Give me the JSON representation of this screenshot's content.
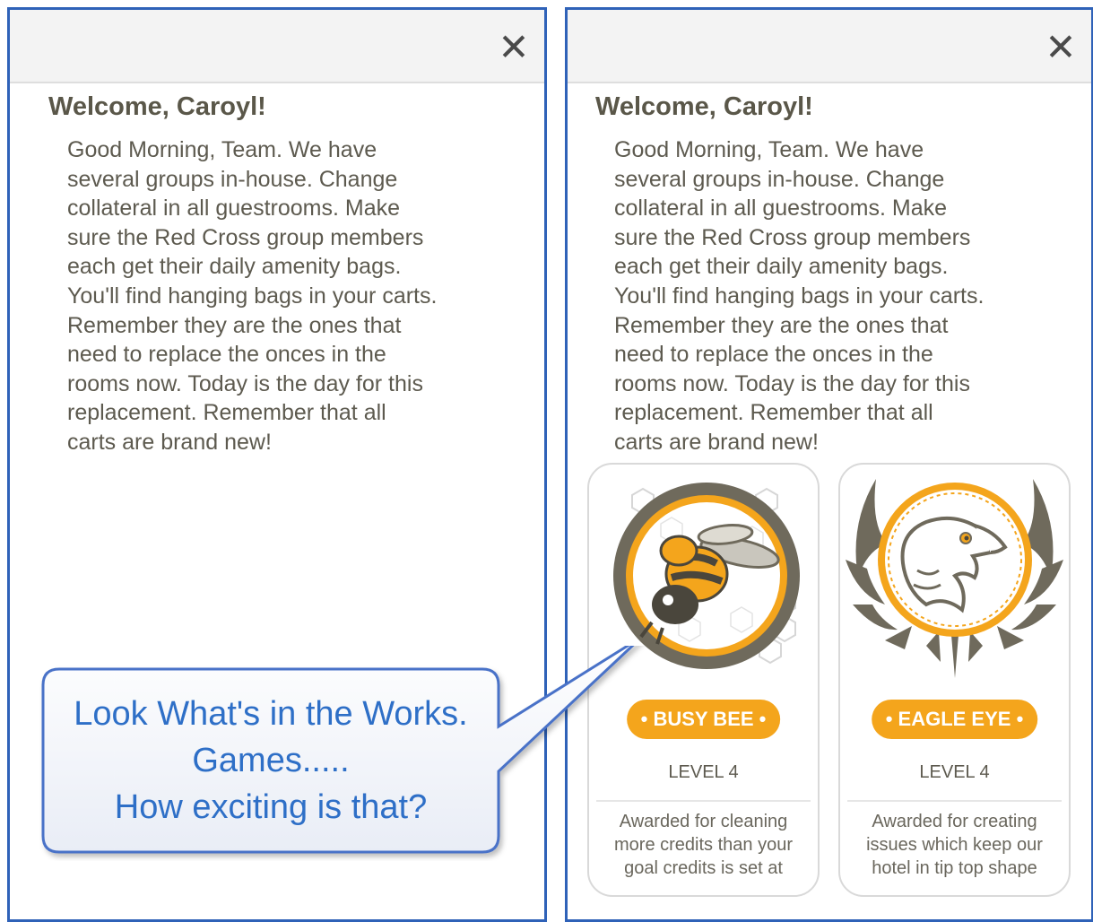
{
  "close_symbol": "✕",
  "left_panel": {
    "welcome": "Welcome, Caroyl!",
    "message_lines": [
      "Good Morning, Team. We have",
      "several groups in-house. Change",
      "collateral in all guestrooms. Make",
      "sure the Red Cross group members",
      "each get their daily amenity bags.",
      "You'll find hanging bags in your carts.",
      "Remember they are the ones that",
      "need to replace the onces in the",
      "rooms now. Today is the day for this",
      "replacement. Remember that all",
      "carts are brand new!"
    ]
  },
  "right_panel": {
    "welcome": "Welcome, Caroyl!",
    "message_lines": [
      "Good Morning, Team. We have",
      "several groups in-house. Change",
      "collateral in all guestrooms. Make",
      "sure the Red Cross group members",
      "each get their daily amenity bags.",
      "You'll find hanging bags in your carts.",
      "Remember they are the ones that",
      "need to replace the onces in the",
      "rooms now. Today is the day for this",
      "replacement. Remember that all",
      "carts are brand new!"
    ],
    "badges": [
      {
        "name": "• BUSY BEE •",
        "level": "LEVEL 4",
        "description": [
          "Awarded for cleaning",
          "more credits than your",
          "goal credits is set at"
        ],
        "icon": "bee-badge-icon"
      },
      {
        "name": "• EAGLE EYE •",
        "level": "LEVEL 4",
        "description": [
          "Awarded for creating",
          "issues which keep our",
          "hotel in tip top shape"
        ],
        "icon": "eagle-badge-icon"
      }
    ]
  },
  "callout": {
    "lines": [
      "Look What's in the Works.",
      "Games.....",
      "How exciting is that?"
    ]
  },
  "colors": {
    "panel_border": "#2f62b8",
    "badge_orange": "#f4a51c",
    "badge_gray": "#6f6a5c",
    "callout_text": "#2e6fc7",
    "callout_border": "#4a72c8"
  }
}
